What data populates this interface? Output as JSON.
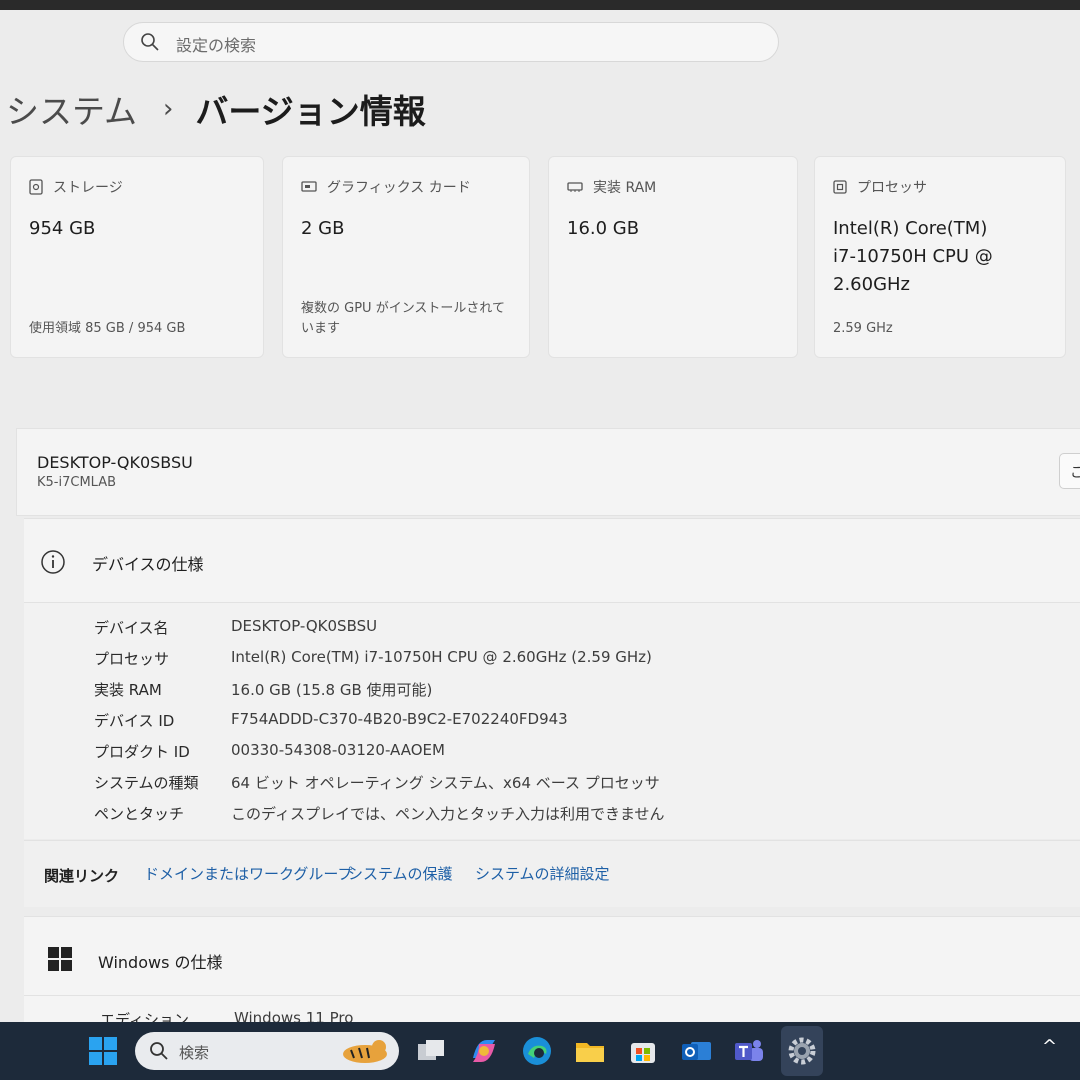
{
  "search": {
    "placeholder": "設定の検索"
  },
  "breadcrumb": {
    "parent": "システム",
    "separator": "›",
    "current": "バージョン情報"
  },
  "cards": [
    {
      "title": "ストレージ",
      "value": "954 GB",
      "sub": "使用領域 85 GB / 954 GB",
      "icon": "storage-icon"
    },
    {
      "title": "グラフィックス カード",
      "value": "2 GB",
      "sub": "複数の GPU がインストールされています",
      "icon": "graphics-card-icon"
    },
    {
      "title": "実装 RAM",
      "value": "16.0 GB",
      "sub": "",
      "icon": "ram-icon"
    },
    {
      "title": "プロセッサ",
      "value": "Intel(R) Core(TM) i7-10750H CPU @ 2.60GHz",
      "sub": "2.59 GHz",
      "icon": "processor-icon"
    }
  ],
  "pc": {
    "name": "DESKTOP-QK0SBSU",
    "model": "K5-i7CMLAB",
    "rename_label": "こ"
  },
  "device_spec": {
    "title": "デバイスの仕様",
    "rows": [
      {
        "key": "デバイス名",
        "value": "DESKTOP-QK0SBSU"
      },
      {
        "key": "プロセッサ",
        "value": "Intel(R) Core(TM) i7-10750H CPU @ 2.60GHz (2.59 GHz)"
      },
      {
        "key": "実装 RAM",
        "value": "16.0 GB (15.8 GB 使用可能)"
      },
      {
        "key": "デバイス ID",
        "value": "F754ADDD-C370-4B20-B9C2-E702240FD943"
      },
      {
        "key": "プロダクト ID",
        "value": "00330-54308-03120-AAOEM"
      },
      {
        "key": "システムの種類",
        "value": "64 ビット オペレーティング システム、x64 ベース プロセッサ"
      },
      {
        "key": "ペンとタッチ",
        "value": "このディスプレイでは、ペン入力とタッチ入力は利用できません"
      }
    ]
  },
  "related_links": {
    "label": "関連リンク",
    "links": [
      "ドメインまたはワークグループ",
      "システムの保護",
      "システムの詳細設定"
    ]
  },
  "windows_spec": {
    "title": "Windows の仕様",
    "edition_key": "エディション",
    "edition_value": "Windows 11 Pro"
  },
  "taskbar": {
    "search_placeholder": "検索",
    "icons": [
      "start-icon",
      "task-view-icon",
      "copilot-icon",
      "edge-icon",
      "file-explorer-icon",
      "store-icon",
      "outlook-icon",
      "teams-icon",
      "settings-icon"
    ],
    "tray_chevron": "^"
  },
  "colors": {
    "link": "#1d5fa6",
    "taskbar": "#1d2a3a",
    "background": "#ececec"
  }
}
